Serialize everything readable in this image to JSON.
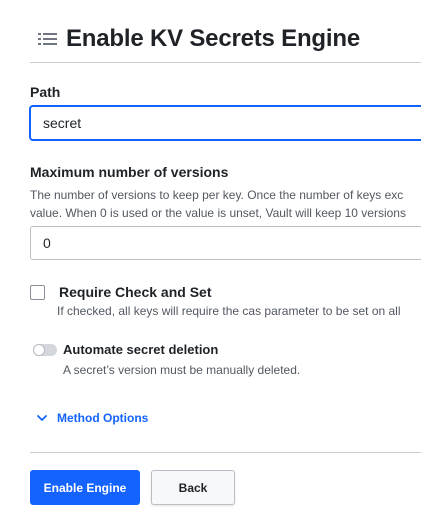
{
  "header": {
    "title": "Enable KV Secrets Engine",
    "icon": "list-icon"
  },
  "path": {
    "label": "Path",
    "value": "secret"
  },
  "max_versions": {
    "label": "Maximum number of versions",
    "help_line1": "The number of versions to keep per key. Once the number of keys exc",
    "help_line2": "value. When 0 is used or the value is unset, Vault will keep 10 versions",
    "value": "0"
  },
  "cas": {
    "label": "Require Check and Set",
    "help": "If checked, all keys will require the cas parameter to be set on all",
    "checked": false
  },
  "auto_delete": {
    "label": "Automate secret deletion",
    "help": "A secret’s version must be manually deleted.",
    "enabled": false
  },
  "method_options": {
    "label": "Method Options"
  },
  "actions": {
    "enable_label": "Enable Engine",
    "back_label": "Back"
  },
  "colors": {
    "accent": "#1563ff",
    "text": "#1f2328",
    "muted": "#525861",
    "border": "#babfc6"
  }
}
